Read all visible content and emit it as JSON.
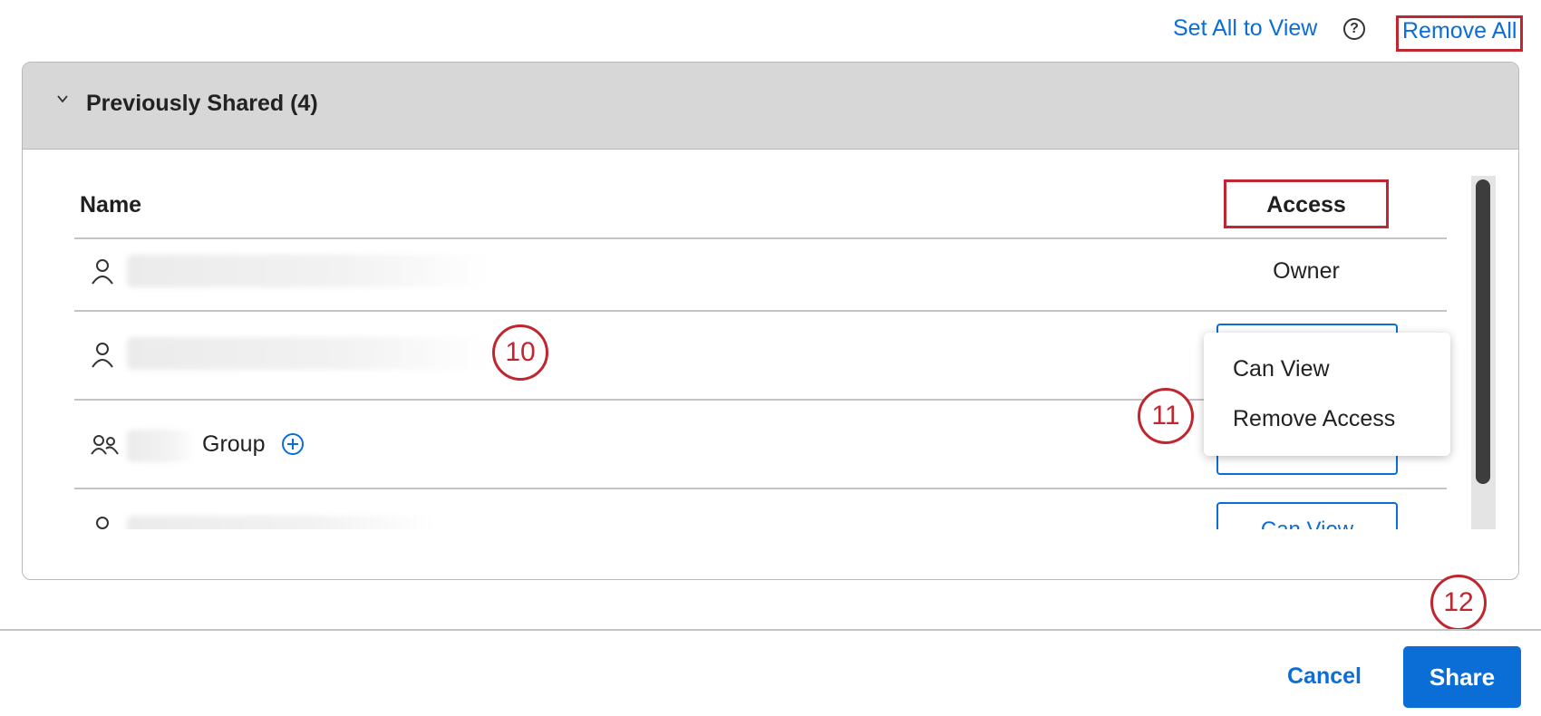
{
  "top_actions": {
    "set_all_label": "Set All to View",
    "help_icon": "question-circle-icon",
    "remove_all_label": "Remove All"
  },
  "panel": {
    "title": "Previously Shared (4)",
    "chevron_icon": "chevron-down-icon",
    "columns": {
      "name": "Name",
      "access": "Access"
    },
    "rows": [
      {
        "type": "user",
        "icon": "person-icon",
        "access": "Owner"
      },
      {
        "type": "user",
        "icon": "person-icon",
        "access": ""
      },
      {
        "type": "group",
        "icon": "group-icon",
        "name_suffix": "Group",
        "extra_icon": "plus-circle-icon",
        "access": ""
      },
      {
        "type": "user",
        "icon": "person-icon",
        "access": "Can View"
      }
    ]
  },
  "access_menu": {
    "items": [
      "Can View",
      "Remove Access"
    ]
  },
  "callouts": [
    "10",
    "11",
    "12"
  ],
  "footer": {
    "cancel_label": "Cancel",
    "share_label": "Share"
  },
  "colors": {
    "accent": "#0b6ed6",
    "annotation": "#c0262f",
    "header_bg": "#d7d7d7"
  }
}
